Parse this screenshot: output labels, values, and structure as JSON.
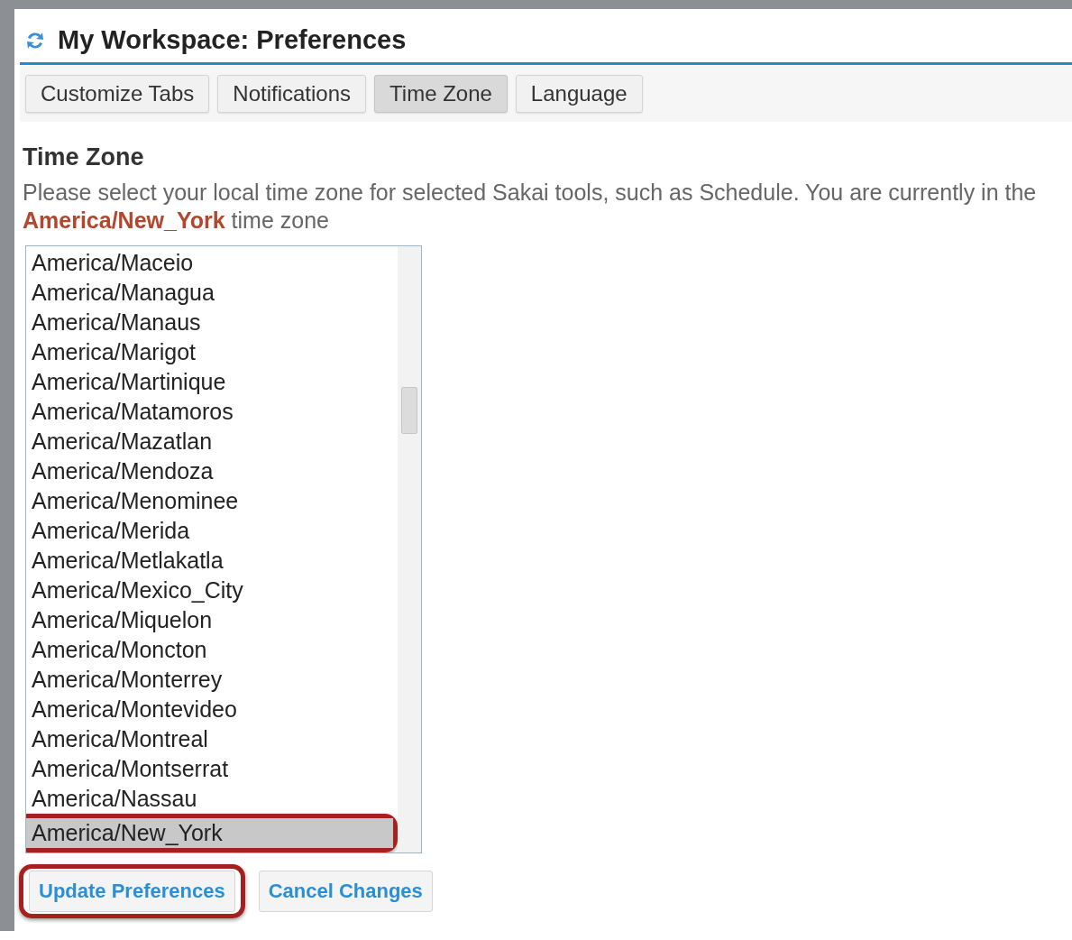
{
  "window": {
    "title": "My Workspace: Preferences"
  },
  "tabs": [
    {
      "label": "Customize Tabs",
      "selected": false
    },
    {
      "label": "Notifications",
      "selected": false
    },
    {
      "label": "Time Zone",
      "selected": true
    },
    {
      "label": "Language",
      "selected": false
    }
  ],
  "section": {
    "heading": "Time Zone",
    "description": "Please select your local time zone for selected Sakai tools, such as Schedule. You are currently in the\n**America/New_York** time zone"
  },
  "timezone_list": {
    "items": [
      {
        "label": "America/Maceio",
        "selected": false
      },
      {
        "label": "America/Managua",
        "selected": false
      },
      {
        "label": "America/Manaus",
        "selected": false
      },
      {
        "label": "America/Marigot",
        "selected": false
      },
      {
        "label": "America/Martinique",
        "selected": false
      },
      {
        "label": "America/Matamoros",
        "selected": false
      },
      {
        "label": "America/Mazatlan",
        "selected": false
      },
      {
        "label": "America/Mendoza",
        "selected": false
      },
      {
        "label": "America/Menominee",
        "selected": false
      },
      {
        "label": "America/Merida",
        "selected": false
      },
      {
        "label": "America/Metlakatla",
        "selected": false
      },
      {
        "label": "America/Mexico_City",
        "selected": false
      },
      {
        "label": "America/Miquelon",
        "selected": false
      },
      {
        "label": "America/Moncton",
        "selected": false
      },
      {
        "label": "America/Monterrey",
        "selected": false
      },
      {
        "label": "America/Montevideo",
        "selected": false
      },
      {
        "label": "America/Montreal",
        "selected": false
      },
      {
        "label": "America/Montserrat",
        "selected": false
      },
      {
        "label": "America/Nassau",
        "selected": false
      },
      {
        "label": "America/New_York",
        "selected": true,
        "highlighted": true
      }
    ]
  },
  "buttons": [
    {
      "label": "Update Preferences",
      "highlighted": true
    },
    {
      "label": "Cancel Changes",
      "highlighted": false
    }
  ]
}
